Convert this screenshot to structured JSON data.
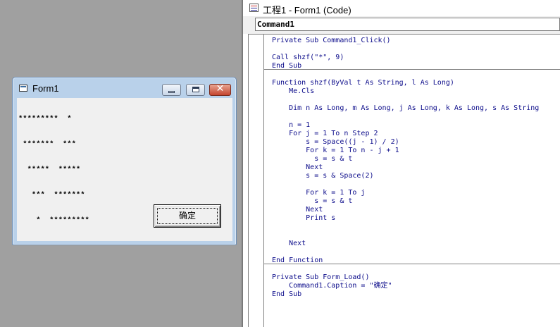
{
  "form": {
    "title": "Form1",
    "output_lines": [
      "*********  *",
      " *******  ***",
      "  *****  *****",
      "   ***  *******",
      "    *  *********"
    ],
    "button_label": "确定",
    "close_glyph": "✕"
  },
  "code_window": {
    "title": "工程1 - Form1 (Code)",
    "object_combo": "Command1",
    "lines": [
      "Private Sub Command1_Click()",
      "",
      "Call shzf(\"*\", 9)",
      "End Sub",
      "",
      "Function shzf(ByVal t As String, l As Long)",
      "    Me.Cls",
      "",
      "    Dim n As Long, m As Long, j As Long, k As Long, s As String",
      "",
      "    n = 1",
      "    For j = 1 To n Step 2",
      "        s = Space((j - 1) / 2)",
      "        For k = 1 To n - j + 1",
      "          s = s & t",
      "        Next",
      "        s = s & Space(2)",
      "",
      "        For k = 1 To j",
      "          s = s & t",
      "        Next",
      "        Print s",
      "",
      "",
      "    Next",
      "",
      "End Function",
      "",
      "Private Sub Form_Load()",
      "    Command1.Caption = \"确定\"",
      "End Sub"
    ]
  }
}
